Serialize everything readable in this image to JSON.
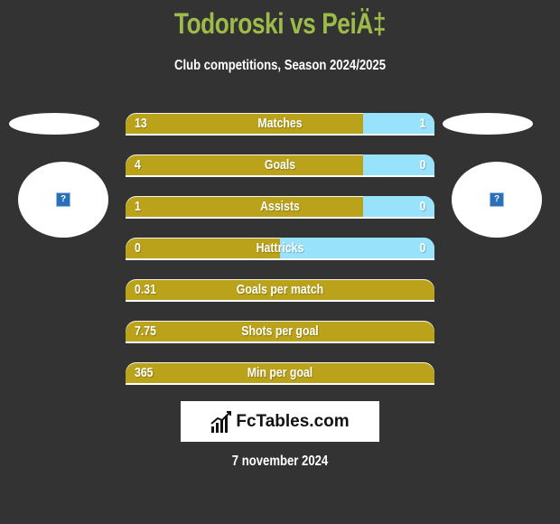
{
  "header": {
    "title": "Todoroski vs PeiÄ‡",
    "subtitle": "Club competitions, Season 2024/2025"
  },
  "players": {
    "left": {
      "name": "Todoroski",
      "avatar_icon": "broken-image-icon"
    },
    "right": {
      "name": "PeiÄ‡",
      "avatar_icon": "broken-image-icon"
    }
  },
  "colors": {
    "title": "#9dbb48",
    "left_bar": "#baa21a",
    "right_bar": "#98e3fb",
    "background": "#333333"
  },
  "stats": [
    {
      "label": "Matches",
      "left": "13",
      "right": "1",
      "right_share": 0.23
    },
    {
      "label": "Goals",
      "left": "4",
      "right": "0",
      "right_share": 0.23
    },
    {
      "label": "Assists",
      "left": "1",
      "right": "0",
      "right_share": 0.23
    },
    {
      "label": "Hattricks",
      "left": "0",
      "right": "0",
      "right_share": 0.5
    },
    {
      "label": "Goals per match",
      "left": "0.31",
      "right": "",
      "right_share": 0
    },
    {
      "label": "Shots per goal",
      "left": "7.75",
      "right": "",
      "right_share": 0
    },
    {
      "label": "Min per goal",
      "left": "365",
      "right": "",
      "right_share": 0
    }
  ],
  "footer": {
    "logo_text": "FcTables.com",
    "date": "7 november 2024"
  }
}
